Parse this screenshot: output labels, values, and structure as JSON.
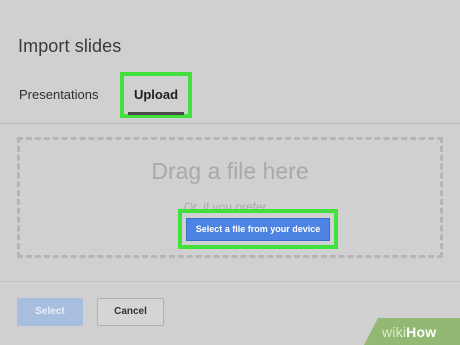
{
  "dialog": {
    "title": "Import slides"
  },
  "tabs": [
    {
      "label": "Presentations",
      "active": false
    },
    {
      "label": "Upload",
      "active": true
    }
  ],
  "upload": {
    "heading": "Drag a file here",
    "or_text": "Or, if you prefer...",
    "select_file_label": "Select a file from your device"
  },
  "footer": {
    "select_label": "Select",
    "cancel_label": "Cancel"
  },
  "watermark": {
    "wiki": "wiki",
    "how": "How"
  },
  "colors": {
    "highlight": "#41e03c",
    "primary_button": "#4d84e3",
    "disabled_button": "#a8bedf"
  }
}
